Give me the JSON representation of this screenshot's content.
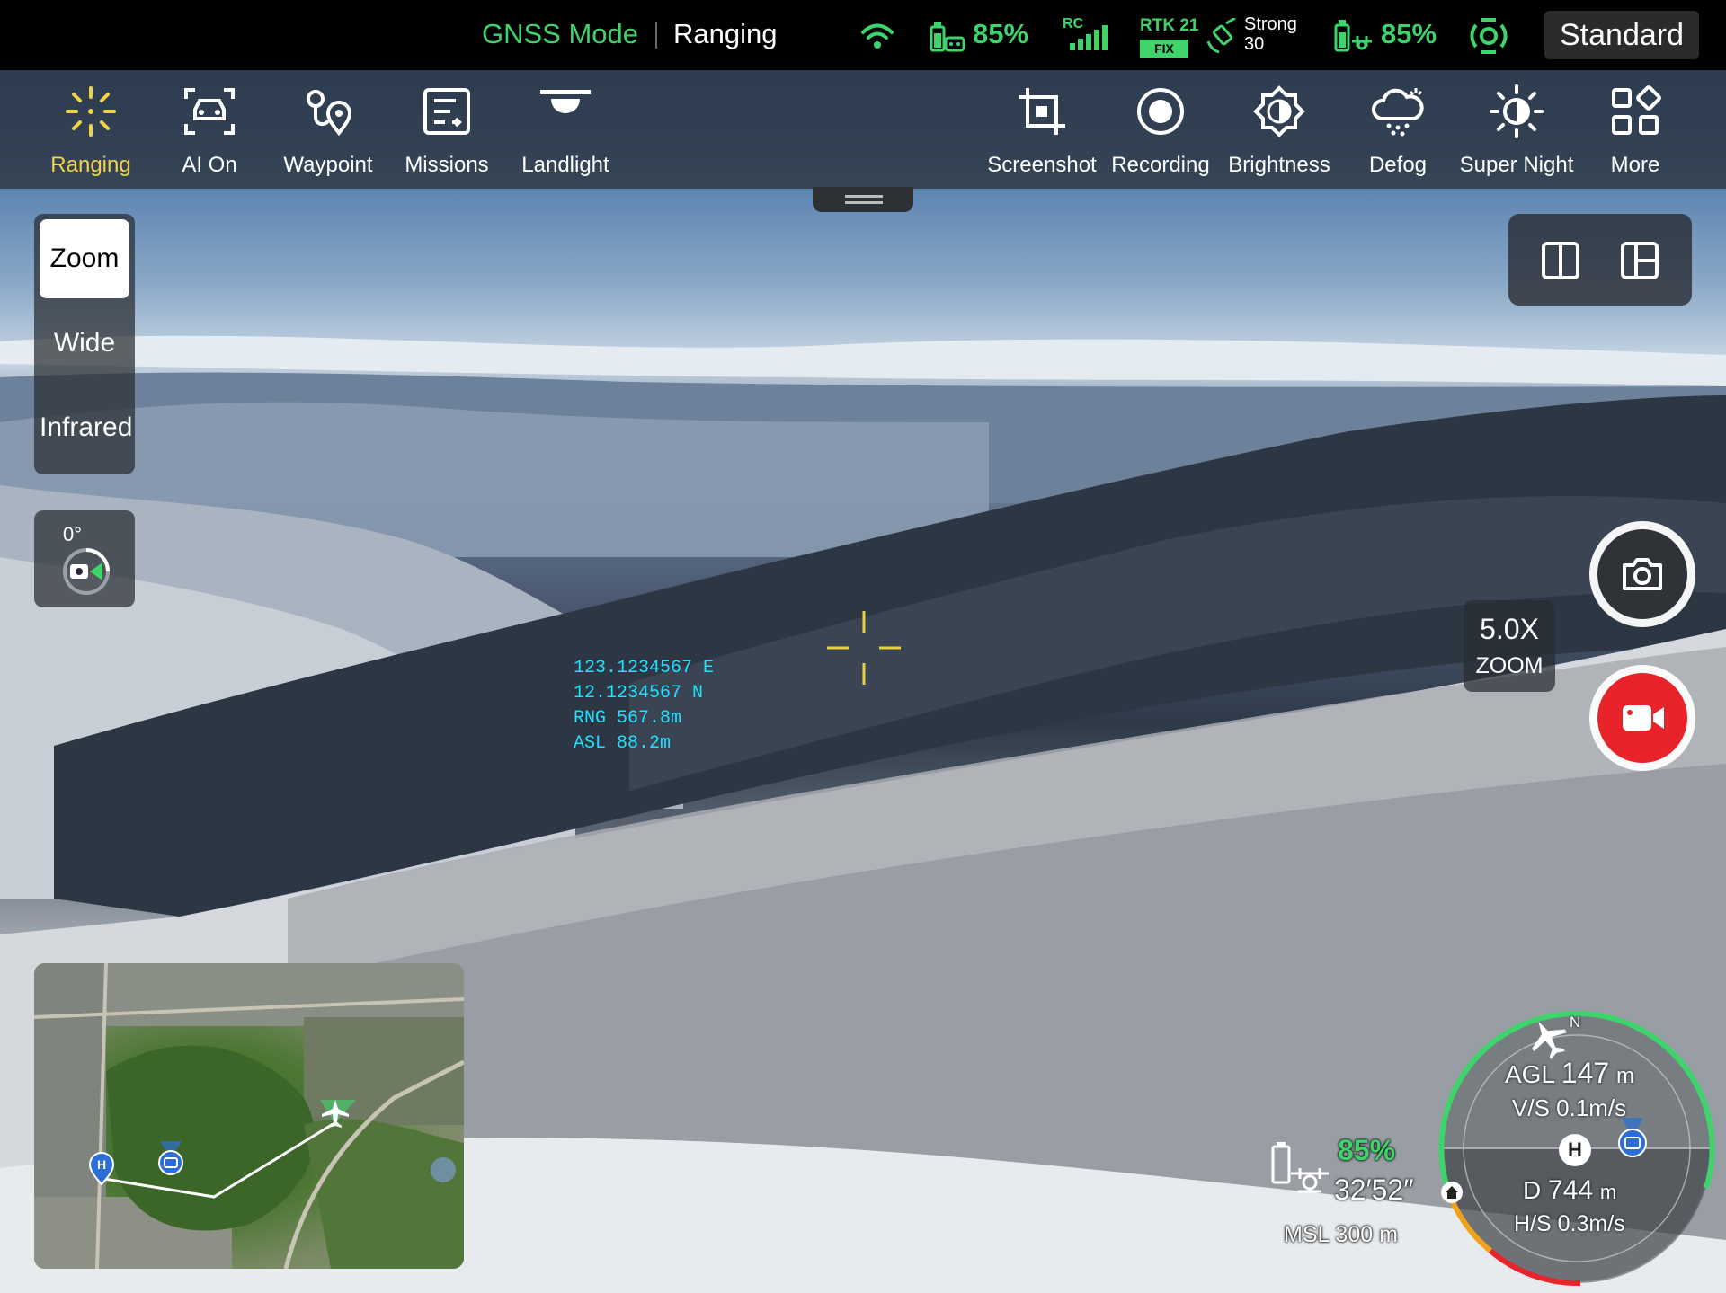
{
  "status_bar": {
    "gnss_mode": "GNSS Mode",
    "ranging": "Ranging",
    "rc_battery_pct": "85%",
    "rc_label": "RC",
    "rtk_label": "RTK 21",
    "rtk_fix": "FIX",
    "signal_label": "Strong",
    "satellite_count": "30",
    "aircraft_battery_pct": "85%",
    "mode": "Standard",
    "icons": [
      "wifi-icon",
      "controller-battery-icon",
      "rc-signal-icon",
      "rtk-icon",
      "satellite-icon",
      "aircraft-battery-icon",
      "obstacle-sensing-icon"
    ]
  },
  "toolbar": {
    "left": [
      {
        "label": "Ranging",
        "icon": "ranging-icon",
        "active": true
      },
      {
        "label": "AI On",
        "icon": "ai-car-icon",
        "active": false
      },
      {
        "label": "Waypoint",
        "icon": "waypoint-icon",
        "active": false
      },
      {
        "label": "Missions",
        "icon": "missions-icon",
        "active": false
      },
      {
        "label": "Landlight",
        "icon": "landlight-icon",
        "active": false
      }
    ],
    "right": [
      {
        "label": "Screenshot",
        "icon": "screenshot-icon"
      },
      {
        "label": "Recording",
        "icon": "recording-icon"
      },
      {
        "label": "Brightness",
        "icon": "brightness-icon"
      },
      {
        "label": "Defog",
        "icon": "defog-icon"
      },
      {
        "label": "Super Night",
        "icon": "super-night-icon"
      },
      {
        "label": "More",
        "icon": "more-icon"
      }
    ]
  },
  "lens": {
    "options": [
      "Zoom",
      "Wide",
      "Infrared"
    ],
    "selected": "Zoom"
  },
  "gimbal": {
    "angle": "0°"
  },
  "ranging_target": {
    "lon": "123.1234567 E",
    "lat": "12.1234567 N",
    "rng": "RNG  567.8m",
    "asl": "ASL  88.2m"
  },
  "zoom": {
    "value": "5.0X",
    "unit": "ZOOM"
  },
  "telemetry": {
    "battery_pct": "85%",
    "flight_time": "32′52″",
    "msl": "MSL 300 m",
    "agl_label": "AGL",
    "agl_value": "147",
    "agl_unit": "m",
    "vs": "V/S 0.1m/s",
    "distance_label": "D",
    "distance_value": "744",
    "distance_unit": "m",
    "hs": "H/S 0.3m/s",
    "compass_north": "N",
    "home_marker": "H"
  },
  "colors": {
    "accent_green": "#3fd36b",
    "active_yellow": "#f1d349",
    "ranging_cyan": "#20e0ff",
    "record_red": "#e8232a"
  }
}
